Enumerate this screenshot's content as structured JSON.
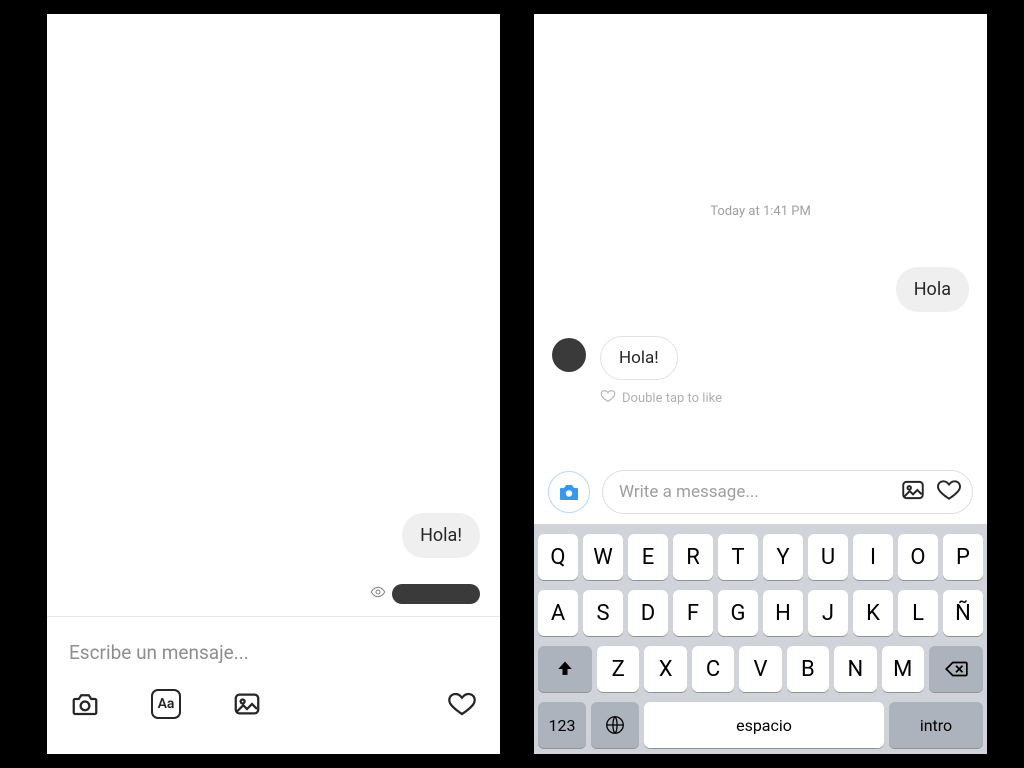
{
  "left": {
    "outgoing_message": "Hola!",
    "input_placeholder": "Escribe un mensaje...",
    "toolbar": {
      "aa_label": "Aa"
    }
  },
  "right": {
    "timestamp": "Today at 1:41 PM",
    "outgoing_message": "Hola",
    "incoming_message": "Hola!",
    "like_hint": "Double tap to like",
    "input_placeholder": "Write a message..."
  },
  "keyboard": {
    "row1": [
      "Q",
      "W",
      "E",
      "R",
      "T",
      "Y",
      "U",
      "I",
      "O",
      "P"
    ],
    "row2": [
      "A",
      "S",
      "D",
      "F",
      "G",
      "H",
      "J",
      "K",
      "L",
      "Ñ"
    ],
    "row3": [
      "Z",
      "X",
      "C",
      "V",
      "B",
      "N",
      "M"
    ],
    "numbers_label": "123",
    "space_label": "espacio",
    "enter_label": "intro"
  }
}
